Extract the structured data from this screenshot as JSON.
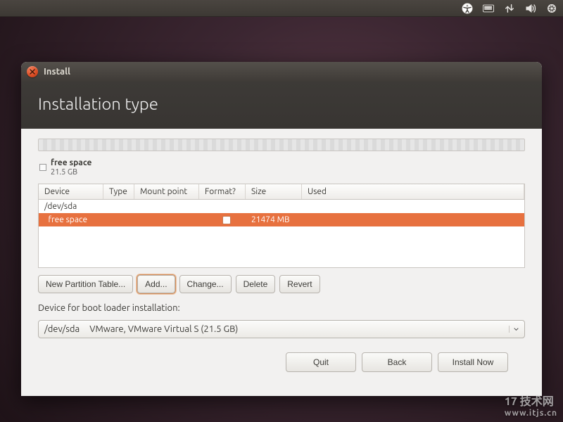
{
  "panel": {
    "icons": [
      "accessibility-icon",
      "keyboard-icon",
      "network-icon",
      "volume-icon",
      "power-icon"
    ]
  },
  "window": {
    "title": "Install",
    "heading": "Installation type"
  },
  "legend": {
    "name": "free space",
    "size": "21.5 GB"
  },
  "table": {
    "headers": {
      "device": "Device",
      "type": "Type",
      "mount": "Mount point",
      "format": "Format?",
      "size": "Size",
      "used": "Used"
    },
    "disk_row": "/dev/sda",
    "selected_row": {
      "device": "  free space",
      "type": "",
      "mount": "",
      "format_checked": false,
      "size": "21474 MB",
      "used": ""
    }
  },
  "buttons": {
    "new_table": "New Partition Table...",
    "add": "Add...",
    "change": "Change...",
    "delete": "Delete",
    "revert": "Revert"
  },
  "bootloader": {
    "label": "Device for boot loader installation:",
    "device": "/dev/sda",
    "desc": "VMware, VMware Virtual S (21.5 GB)"
  },
  "footer": {
    "quit": "Quit",
    "back": "Back",
    "install": "Install Now"
  },
  "watermark": {
    "line1": "17 技术网",
    "line2": "www.itjs.cn"
  }
}
